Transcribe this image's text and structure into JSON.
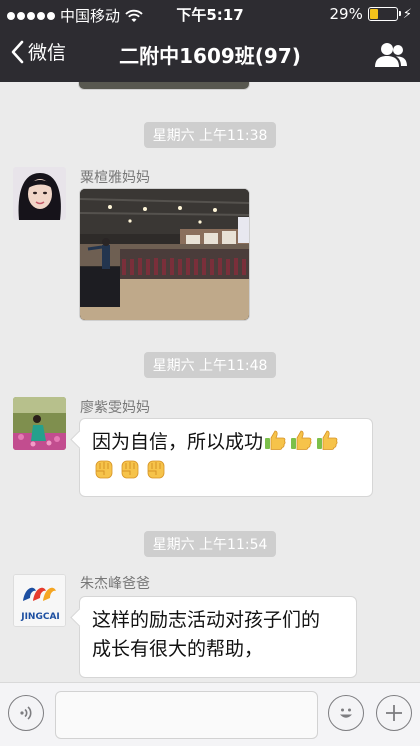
{
  "status": {
    "carrier": "中国移动",
    "time": "下午5:17",
    "battery": "29%"
  },
  "nav": {
    "back_label": "微信",
    "title": "二附中1609班(97)"
  },
  "messages": [
    {
      "time": "星期六 上午11:38",
      "sender": "粟楦雅妈妈",
      "type": "image"
    },
    {
      "time": "星期六 上午11:48",
      "sender": "廖紫雯妈妈",
      "type": "text",
      "text": "因为自信，所以成功"
    },
    {
      "time": "星期六 上午11:54",
      "sender": "朱杰峰爸爸",
      "avatar_text": "JINGCAI",
      "type": "text",
      "line1": "这样的励志活动对孩子们的",
      "line2": "成长有很大的帮助，"
    }
  ],
  "colors": {
    "nav_bg": "#2d2c31",
    "chat_bg": "#ebebeb",
    "battery": "#f3c21b"
  }
}
